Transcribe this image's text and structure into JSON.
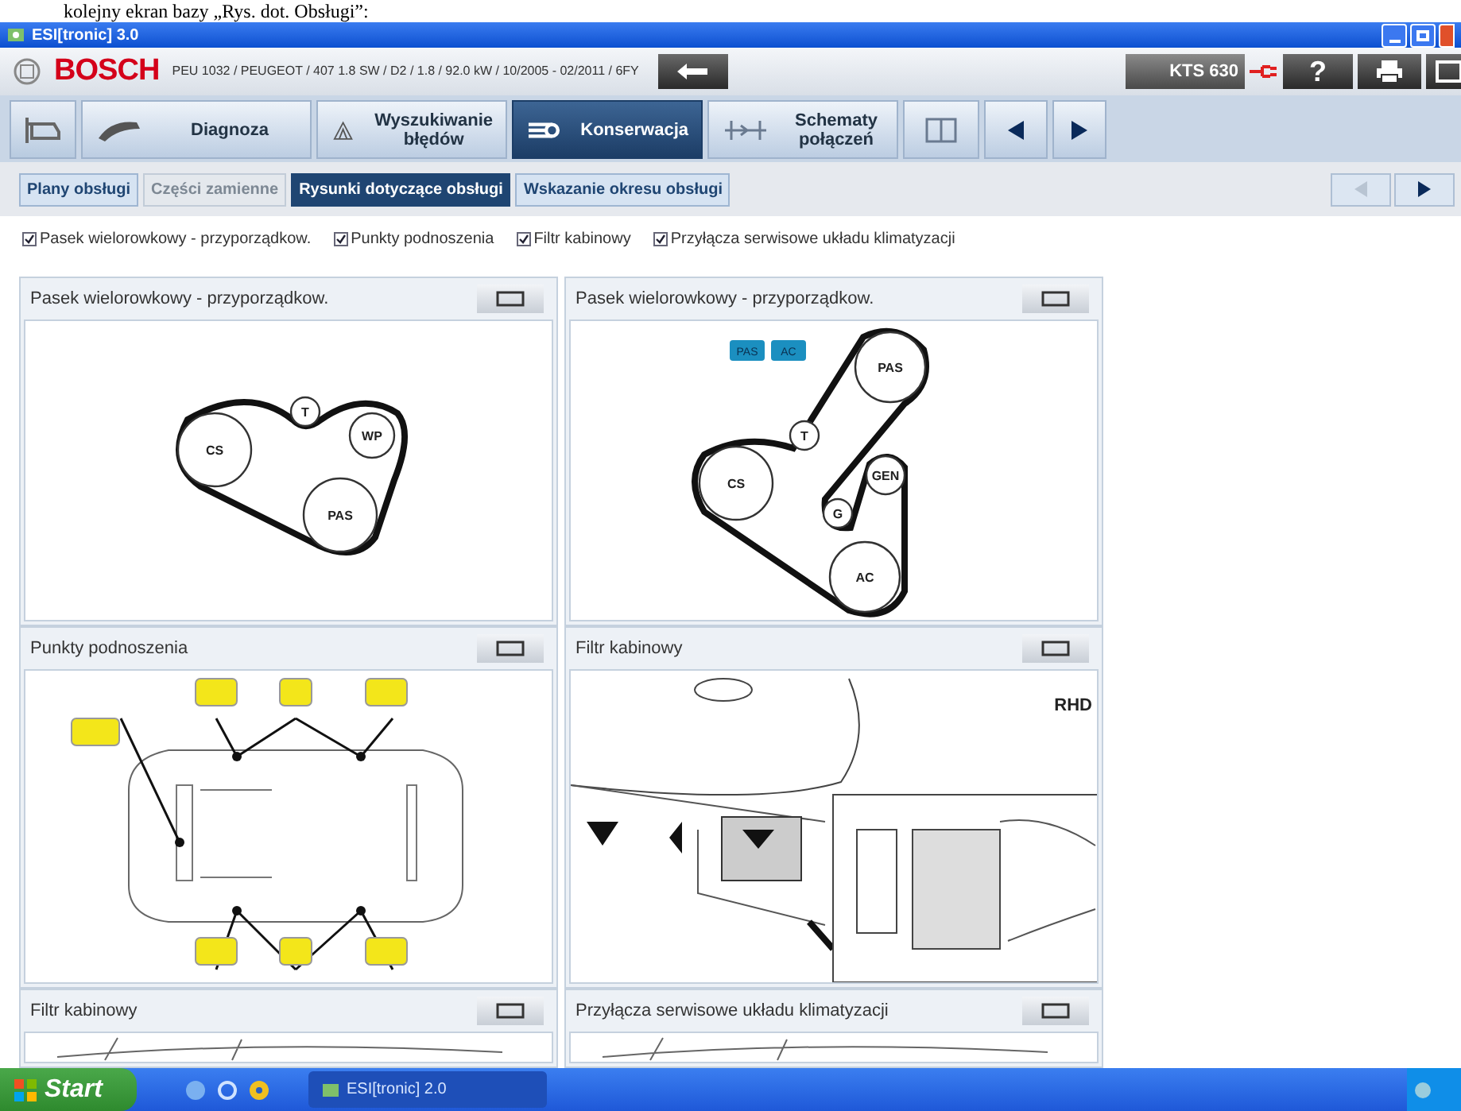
{
  "caption": "kolejny ekran bazy „Rys. dot. Obsługi”:",
  "window": {
    "title": "ESI[tronic] 3.0"
  },
  "header": {
    "brand": "BOSCH",
    "vehicle": "PEU 1032 / PEUGEOT / 407 1.8 SW / D2 / 1.8 / 92.0 kW / 10/2005 - 02/2011 / 6FY",
    "device": "KTS 630",
    "help": "?"
  },
  "tabs": [
    {
      "label": "Diagnoza",
      "selected": false
    },
    {
      "label": "Wyszukiwanie błędów",
      "selected": false
    },
    {
      "label": "Konserwacja",
      "selected": true
    },
    {
      "label": "Schematy połączeń",
      "selected": false
    }
  ],
  "subtabs": [
    {
      "label": "Plany obsługi",
      "selected": false,
      "disabled": false
    },
    {
      "label": "Części zamienne",
      "selected": false,
      "disabled": true
    },
    {
      "label": "Rysunki dotyczące obsługi",
      "selected": true,
      "disabled": false
    },
    {
      "label": "Wskazanie okresu obsługi",
      "selected": false,
      "disabled": false
    }
  ],
  "filters": [
    {
      "label": "Pasek wielorowkowy - przyporządkow.",
      "checked": true
    },
    {
      "label": "Punkty podnoszenia",
      "checked": true
    },
    {
      "label": "Filtr kabinowy",
      "checked": true
    },
    {
      "label": "Przyłącza serwisowe układu klimatyzacji",
      "checked": true
    }
  ],
  "panels": [
    {
      "title": "Pasek wielorowkowy - przyporządkow.",
      "kind": "belt_a",
      "pulleys": [
        "CS",
        "T",
        "WP",
        "PAS"
      ]
    },
    {
      "title": "Pasek wielorowkowy - przyporządkow.",
      "kind": "belt_b",
      "pulleys": [
        "PAS",
        "T",
        "CS",
        "G",
        "GEN",
        "AC"
      ],
      "badges": [
        "PAS",
        "AC"
      ]
    },
    {
      "title": "Punkty podnoszenia",
      "kind": "lift"
    },
    {
      "title": "Filtr kabinowy",
      "kind": "filter",
      "mark": "RHD"
    },
    {
      "title": "Filtr kabinowy",
      "kind": "partial"
    },
    {
      "title": "Przyłącza serwisowe układu klimatyzacji",
      "kind": "partial"
    }
  ],
  "taskbar": {
    "start": "Start",
    "task": "ESI[tronic] 2.0"
  }
}
